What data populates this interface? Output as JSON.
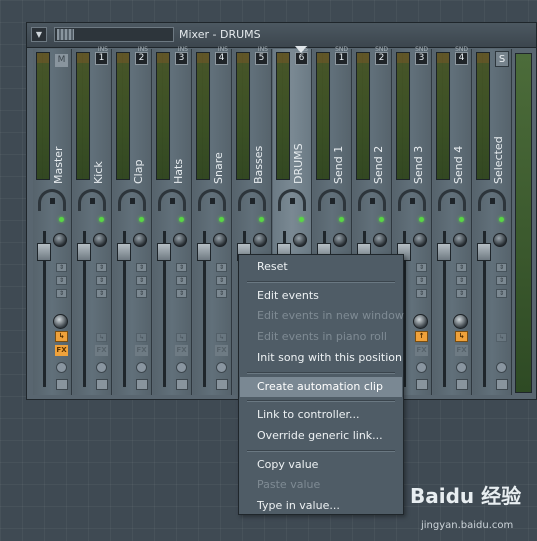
{
  "mixer": {
    "title": "Mixer - DRUMS",
    "tracks": [
      {
        "name": "Master",
        "ins": "",
        "type": "master"
      },
      {
        "name": "Kick",
        "ins": "1",
        "type": "insert"
      },
      {
        "name": "Clap",
        "ins": "2",
        "type": "insert"
      },
      {
        "name": "Hats",
        "ins": "3",
        "type": "insert"
      },
      {
        "name": "Snare",
        "ins": "4",
        "type": "insert"
      },
      {
        "name": "Basses",
        "ins": "5",
        "type": "insert"
      },
      {
        "name": "DRUMS",
        "ins": "6",
        "type": "insert",
        "selected": true
      },
      {
        "name": "Send 1",
        "ins": "1",
        "type": "send"
      },
      {
        "name": "Send 2",
        "ins": "2",
        "type": "send"
      },
      {
        "name": "Send 3",
        "ins": "3",
        "type": "send"
      },
      {
        "name": "Send 4",
        "ins": "4",
        "type": "send"
      },
      {
        "name": "Selected",
        "ins": "S",
        "type": "selected"
      }
    ],
    "ins_label": "INS",
    "snd_label": "SND",
    "fx_label": "FX",
    "master_icon": "M",
    "selected_icon": "S",
    "active_color": "#f0a23b",
    "led_color": "#59d645"
  },
  "context_menu": {
    "items": [
      {
        "label": "Reset",
        "enabled": true
      },
      {
        "separator": true
      },
      {
        "label": "Edit events",
        "enabled": true
      },
      {
        "label": "Edit events in new window",
        "enabled": false
      },
      {
        "label": "Edit events in piano roll",
        "enabled": false
      },
      {
        "label": "Init song with this position",
        "enabled": true
      },
      {
        "separator": true
      },
      {
        "label": "Create automation clip",
        "enabled": true,
        "highlighted": true
      },
      {
        "separator": true
      },
      {
        "label": "Link to controller...",
        "enabled": true
      },
      {
        "label": "Override generic link...",
        "enabled": true
      },
      {
        "separator": true
      },
      {
        "label": "Copy value",
        "enabled": true
      },
      {
        "label": "Paste value",
        "enabled": false
      },
      {
        "label": "Type in value...",
        "enabled": true
      }
    ]
  },
  "watermark": {
    "brand": "Baidu 经验",
    "url": "jingyan.baidu.com"
  }
}
